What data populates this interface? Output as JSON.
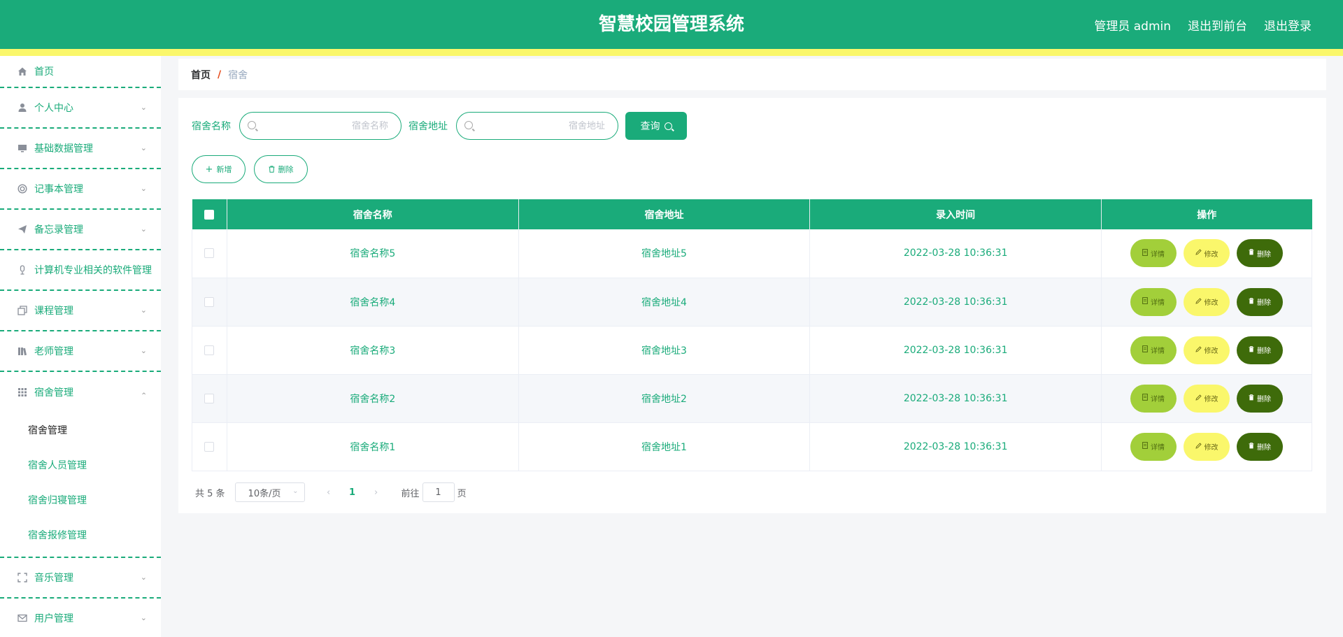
{
  "colors": {
    "primary": "#1aab7a",
    "stripe": "#faf76b",
    "detail": "#a2cf3a",
    "edit": "#faf76b",
    "delete": "#3e6b0a"
  },
  "header": {
    "title": "智慧校园管理系统",
    "user": "管理员 admin",
    "to_front": "退出到前台",
    "logout": "退出登录"
  },
  "sidebar": {
    "items": [
      {
        "label": "首页",
        "icon": "home-icon"
      },
      {
        "label": "个人中心",
        "icon": "user-icon"
      },
      {
        "label": "基础数据管理",
        "icon": "monitor-icon"
      },
      {
        "label": "记事本管理",
        "icon": "lifebuoy-icon"
      },
      {
        "label": "备忘录管理",
        "icon": "send-icon"
      },
      {
        "label": "计算机专业相关的软件管理",
        "icon": "microphone-icon"
      },
      {
        "label": "课程管理",
        "icon": "copy-icon"
      },
      {
        "label": "老师管理",
        "icon": "books-icon"
      },
      {
        "label": "宿舍管理",
        "icon": "grid-icon"
      },
      {
        "label": "音乐管理",
        "icon": "fullscreen-icon"
      },
      {
        "label": "用户管理",
        "icon": "mail-icon"
      }
    ],
    "sub_items": [
      "宿舍管理",
      "宿舍人员管理",
      "宿舍归寝管理",
      "宿舍报修管理"
    ]
  },
  "breadcrumb": {
    "home": "首页",
    "separator": "/",
    "current": "宿舍"
  },
  "search": {
    "name_label": "宿舍名称",
    "name_placeholder": "宿舍名称",
    "addr_label": "宿舍地址",
    "addr_placeholder": "宿舍地址",
    "query_label": "查询"
  },
  "actions": {
    "add_label": "新增",
    "delete_label": "删除"
  },
  "table": {
    "headers": [
      "宿舍名称",
      "宿舍地址",
      "录入时间",
      "操作"
    ],
    "rows": [
      {
        "name": "宿舍名称5",
        "address": "宿舍地址5",
        "time": "2022-03-28 10:36:31"
      },
      {
        "name": "宿舍名称4",
        "address": "宿舍地址4",
        "time": "2022-03-28 10:36:31"
      },
      {
        "name": "宿舍名称3",
        "address": "宿舍地址3",
        "time": "2022-03-28 10:36:31"
      },
      {
        "name": "宿舍名称2",
        "address": "宿舍地址2",
        "time": "2022-03-28 10:36:31"
      },
      {
        "name": "宿舍名称1",
        "address": "宿舍地址1",
        "time": "2022-03-28 10:36:31"
      }
    ],
    "op_detail": "详情",
    "op_edit": "修改",
    "op_delete": "删除"
  },
  "pagination": {
    "total": "共 5 条",
    "page_size": "10条/页",
    "current_page": "1",
    "goto_prefix": "前往",
    "goto_value": "1",
    "goto_suffix": "页"
  }
}
